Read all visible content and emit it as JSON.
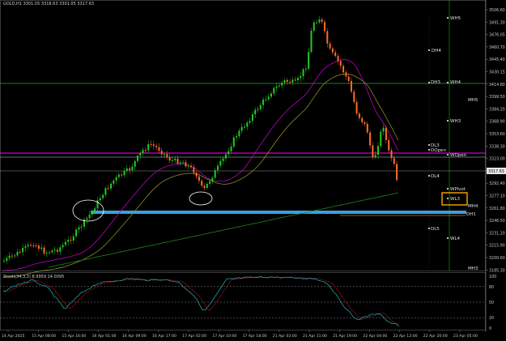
{
  "header": {
    "symbol": "GOLD,H1",
    "ohlc": "3301.05 3318.63 3301.05 3317.63"
  },
  "stoch_header": {
    "label": "Stoch(34,3,3) 8.9959 14.0095"
  },
  "price_axis": {
    "ticks": [
      "3506.60",
      "3491.30",
      "3476.05",
      "3460.70",
      "3445.40",
      "3430.15",
      "3414.80",
      "3399.50",
      "3384.20",
      "3368.90",
      "3353.60",
      "3338.30",
      "3323.00",
      "3307.70",
      "3292.40",
      "3277.10",
      "3261.80",
      "3246.50",
      "3231.20",
      "3215.90",
      "3200.60",
      "3185.30"
    ],
    "current_price": "3317.63"
  },
  "stoch_axis": {
    "ticks": [
      "100",
      "80",
      "50",
      "20",
      "0"
    ]
  },
  "time_axis": {
    "labels": [
      "14 Apr 2025",
      "15 Apr 08:00",
      "15 Apr 16:00",
      "16 Apr 01:00",
      "16 Apr 09:00",
      "16 Apr 17:00",
      "17 Apr 02:00",
      "17 Apr 10:00",
      "17 Apr 18:00",
      "21 Apr 03:00",
      "21 Apr 11:00",
      "21 Apr 19:00",
      "22 Apr 04:00",
      "22 Apr 12:00",
      "22 Apr 20:00",
      "23 Apr 05:00"
    ]
  },
  "levels": {
    "WH5": "WH5",
    "DH4": "DH4",
    "DH3": "DH3",
    "WH4": "WH4",
    "MH5": "MH5",
    "WH3": "WH3",
    "DL3": "DL3",
    "DOpen": "DOpen",
    "WOpen": "WOpen",
    "DL4": "DL4",
    "WPivot": "WPivot",
    "WL3": "WL3",
    "MH4": "MH4",
    "DH1": "DH1",
    "DL5": "DL5",
    "WL4": "WL4",
    "MH3": "MH3"
  },
  "colors": {
    "background": "#000000",
    "bull": "#22cc22",
    "bear": "#ff6a2a",
    "ma_magenta": "#c000c0",
    "ma_olive": "#8a8a30",
    "ma_green": "#208020",
    "wopen_line": "#ff00ff",
    "support_band": "#3aa0e0",
    "annotation_box": "#ffa500",
    "stoch_main": "#2ab0c0",
    "stoch_signal": "#ff2020"
  }
}
